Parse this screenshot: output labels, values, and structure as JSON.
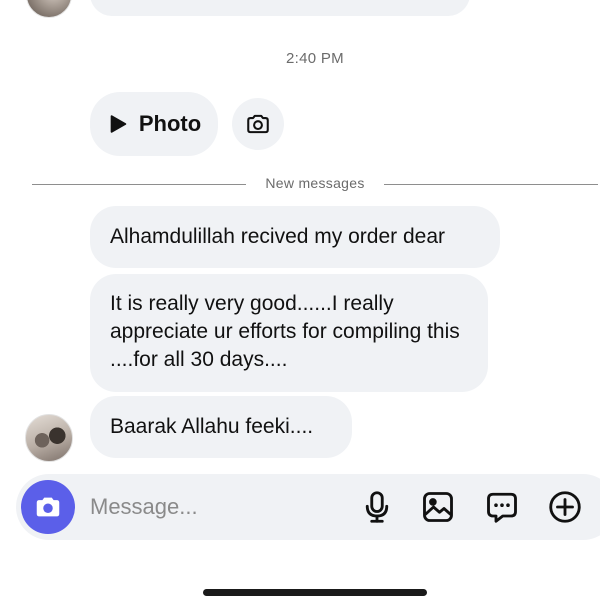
{
  "thread": {
    "timestamp": "2:40 PM",
    "photo_label": "Photo",
    "divider_label": "New messages",
    "messages": [
      "Alhamdulillah recived my order dear",
      "It is really very good......I really appreciate ur efforts for compiling this ....for all 30 days....",
      "Baarak Allahu feeki...."
    ]
  },
  "composer": {
    "placeholder": "Message..."
  },
  "colors": {
    "bubble": "#f0f2f5",
    "accent": "#5b5fe9",
    "muted_text": "#6b6b6b"
  },
  "icons": [
    "play-icon",
    "camera-icon",
    "microphone-icon",
    "gallery-icon",
    "sticker-icon",
    "plus-circle-icon"
  ]
}
